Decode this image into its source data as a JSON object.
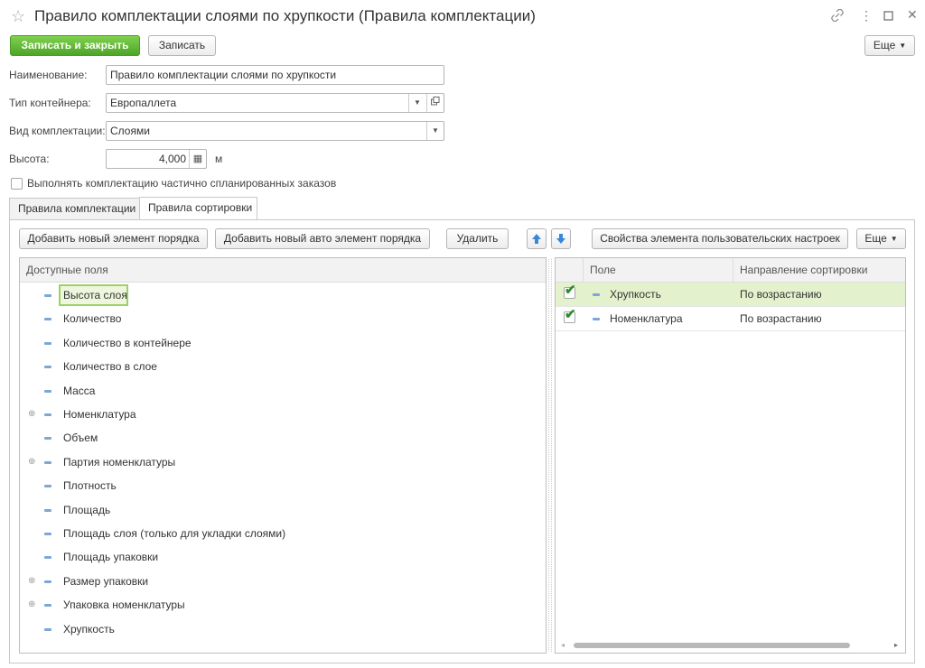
{
  "window": {
    "title": "Правило комплектации слоями по хрупкости (Правила комплектации)",
    "icons": {
      "star": "star-icon",
      "link": "link-icon",
      "more": "more-vertical-icon",
      "maximize": "maximize-icon",
      "close": "close-icon"
    }
  },
  "toolbar": {
    "save_close_label": "Записать и закрыть",
    "save_label": "Записать",
    "more_label": "Еще"
  },
  "form": {
    "name_label": "Наименование:",
    "name_value": "Правило комплектации слоями по хрупкости",
    "container_label": "Тип контейнера:",
    "container_value": "Европаллета",
    "type_label": "Вид комплектации:",
    "type_value": "Слоями",
    "height_label": "Высота:",
    "height_value": "4,000",
    "height_unit": "м",
    "partial_label": "Выполнять комплектацию частично спланированных заказов"
  },
  "tabs": [
    {
      "label": "Правила комплектации",
      "active": false
    },
    {
      "label": "Правила сортировки",
      "active": true
    }
  ],
  "sort_toolbar": {
    "add_item": "Добавить новый элемент порядка",
    "add_auto_item": "Добавить новый авто элемент порядка",
    "delete": "Удалить",
    "props": "Свойства элемента пользовательских настроек",
    "more": "Еще"
  },
  "available_fields": {
    "header": "Доступные поля",
    "items": [
      {
        "label": "Высота слоя",
        "expandable": false,
        "selected": true
      },
      {
        "label": "Количество",
        "expandable": false
      },
      {
        "label": "Количество в контейнере",
        "expandable": false
      },
      {
        "label": "Количество в слое",
        "expandable": false
      },
      {
        "label": "Масса",
        "expandable": false
      },
      {
        "label": "Номенклатура",
        "expandable": true
      },
      {
        "label": "Объем",
        "expandable": false
      },
      {
        "label": "Партия номенклатуры",
        "expandable": true
      },
      {
        "label": "Плотность",
        "expandable": false
      },
      {
        "label": "Площадь",
        "expandable": false
      },
      {
        "label": "Площадь слоя (только для укладки слоями)",
        "expandable": false
      },
      {
        "label": "Площадь упаковки",
        "expandable": false
      },
      {
        "label": "Размер упаковки",
        "expandable": true
      },
      {
        "label": "Упаковка номенклатуры",
        "expandable": true
      },
      {
        "label": "Хрупкость",
        "expandable": false
      }
    ]
  },
  "sort_table": {
    "col_field": "Поле",
    "col_direction": "Направление сортировки",
    "rows": [
      {
        "checked": true,
        "field": "Хрупкость",
        "direction": "По возрастанию",
        "selected": true
      },
      {
        "checked": true,
        "field": "Номенклатура",
        "direction": "По возрастанию",
        "selected": false
      }
    ]
  },
  "colors": {
    "primary_green": "#5cb82f",
    "selection_green": "#e3f2cc",
    "icon_blue": "#7aa7d8"
  }
}
